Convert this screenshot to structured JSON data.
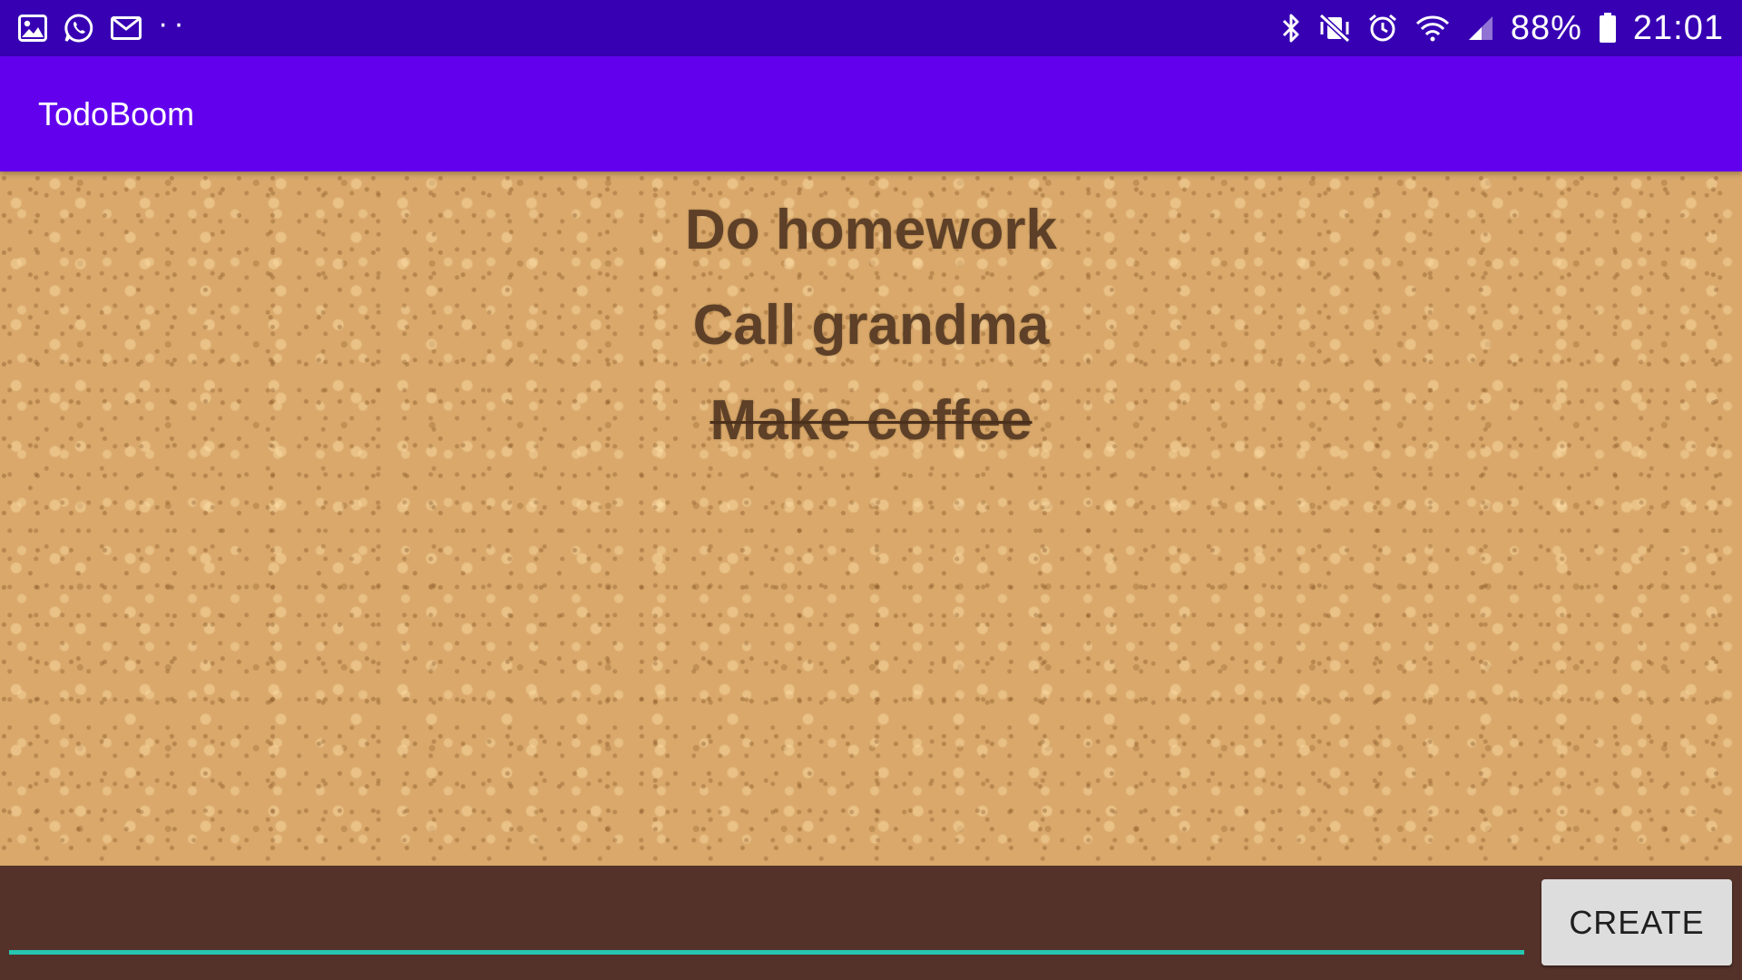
{
  "status_bar": {
    "left_icons": [
      "gallery-icon",
      "whatsapp-icon",
      "gmail-icon",
      "more-notifications-icon"
    ],
    "right_icons": [
      "bluetooth-icon",
      "vibrate-mute-icon",
      "alarm-icon",
      "wifi-icon",
      "cellular-signal-icon",
      "battery-icon"
    ],
    "more_indicator": "··",
    "battery_percent": "88%",
    "time": "21:01",
    "background_color": "#3700b3"
  },
  "app_bar": {
    "title": "TodoBoom",
    "background_color": "#6200ee"
  },
  "todos": [
    {
      "text": "Do homework",
      "done": false
    },
    {
      "text": "Call grandma",
      "done": false
    },
    {
      "text": "Make coffee",
      "done": true
    }
  ],
  "input_bar": {
    "input_value": "",
    "input_placeholder": "",
    "create_label": "CREATE",
    "background_color": "#54322a",
    "underline_color": "#26c6b0"
  }
}
